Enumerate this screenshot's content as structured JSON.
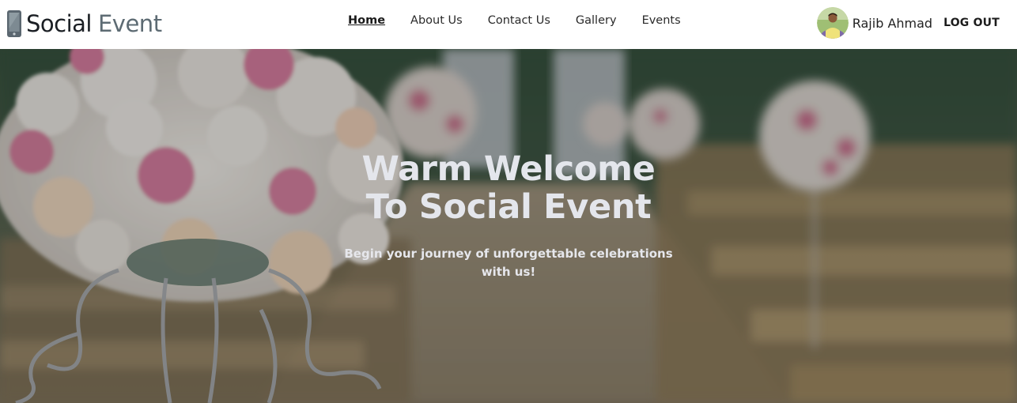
{
  "brand": {
    "name": "Social",
    "accent": "Event",
    "icon": "phone-icon"
  },
  "nav": {
    "items": [
      {
        "label": "Home",
        "active": true
      },
      {
        "label": "About Us",
        "active": false
      },
      {
        "label": "Contact Us",
        "active": false
      },
      {
        "label": "Gallery",
        "active": false
      },
      {
        "label": "Events",
        "active": false
      }
    ]
  },
  "user": {
    "name": "Rajib Ahmad",
    "logout_label": "LOG OUT",
    "avatar": "user-avatar"
  },
  "hero": {
    "title_line1": "Warm Welcome",
    "title_line2": "To Social Event",
    "subtitle": "Begin your journey of unforgettable celebrations with us!",
    "background": "wedding-aisle-flowers-photo"
  },
  "colors": {
    "brand_main": "#1b1f24",
    "brand_accent": "#5d6b73",
    "hero_text": "#e4e6ec"
  }
}
